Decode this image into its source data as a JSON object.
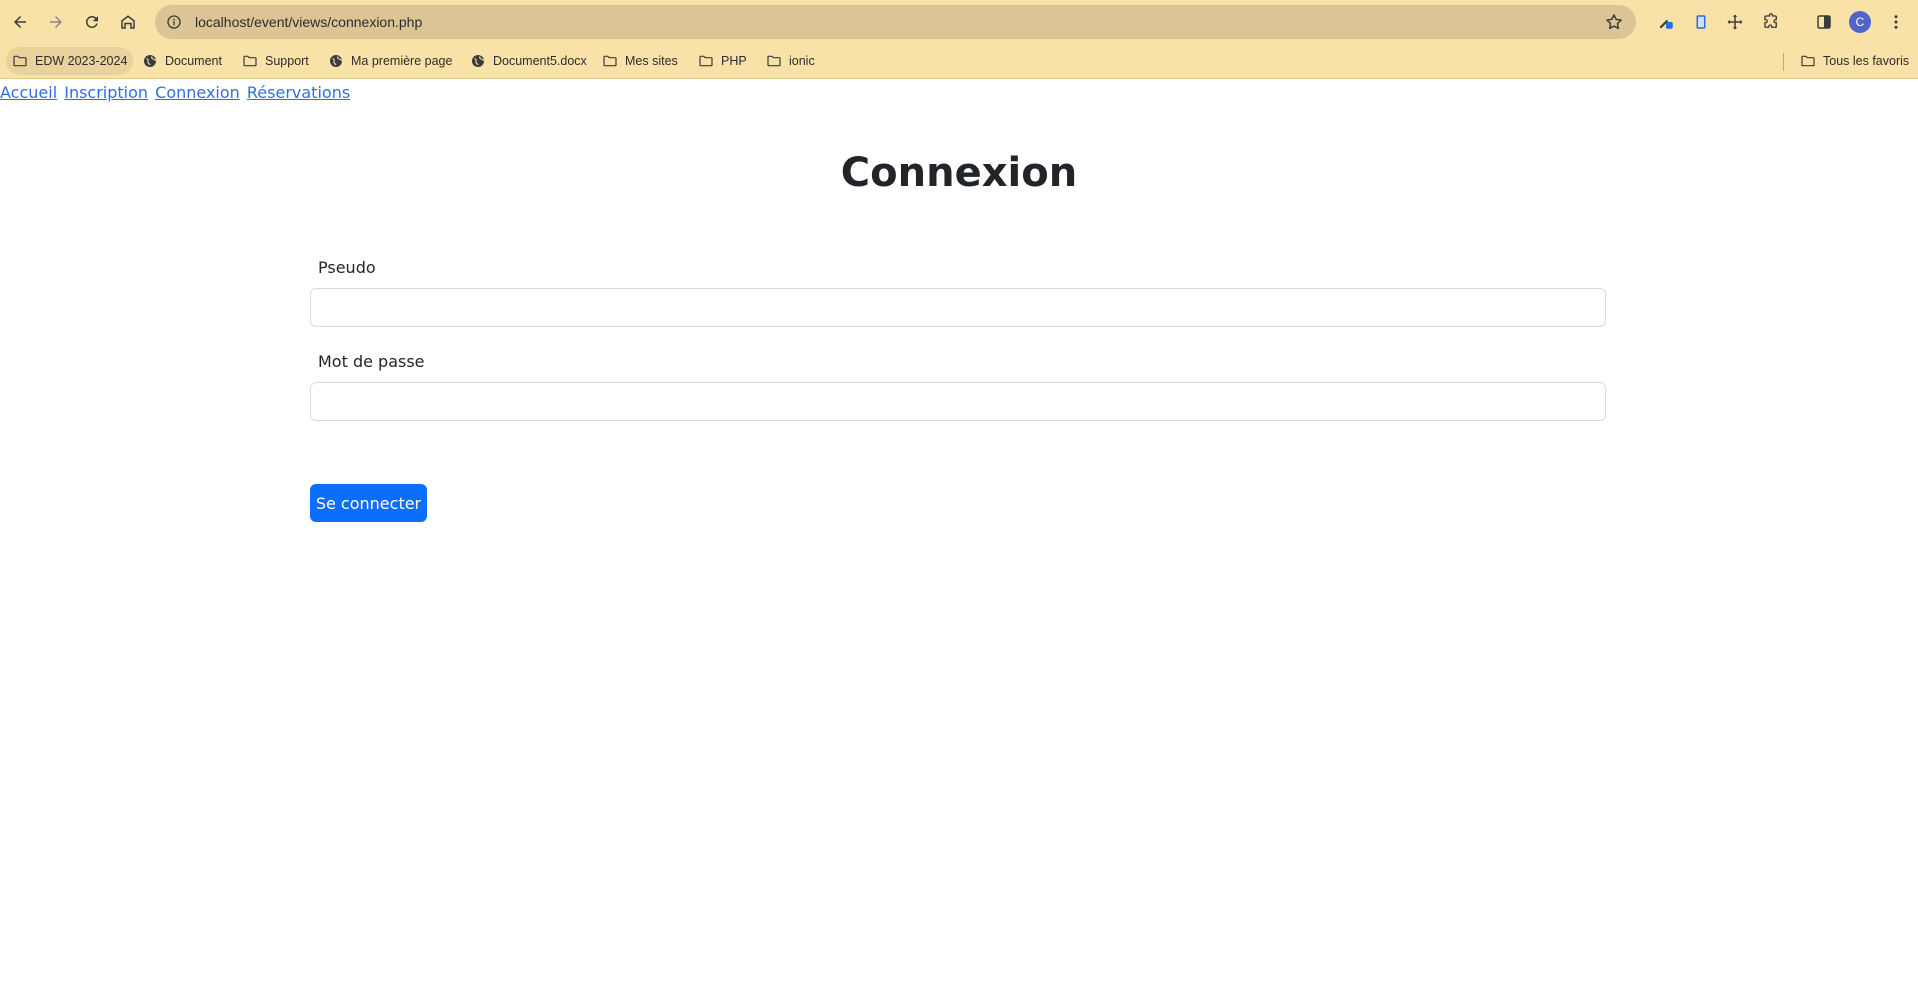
{
  "browser": {
    "url": "localhost/event/views/connexion.php",
    "bookmarks": [
      {
        "label": "EDW 2023-2024",
        "icon": "folder-icon"
      },
      {
        "label": "Document",
        "icon": "globe-icon"
      },
      {
        "label": "Support",
        "icon": "folder-icon"
      },
      {
        "label": "Ma première page",
        "icon": "globe-icon"
      },
      {
        "label": "Document5.docx",
        "icon": "globe-icon"
      },
      {
        "label": "Mes sites",
        "icon": "folder-icon"
      },
      {
        "label": "PHP",
        "icon": "folder-icon"
      },
      {
        "label": "ionic",
        "icon": "folder-icon"
      }
    ],
    "all_bookmarks": "Tous les favoris",
    "profile_initial": "C"
  },
  "nav": {
    "links": [
      "Accueil",
      "Inscription",
      "Connexion",
      "Réservations"
    ]
  },
  "page": {
    "title": "Connexion",
    "pseudo_label": "Pseudo",
    "pseudo_value": "",
    "password_label": "Mot de passe",
    "password_value": "",
    "submit_label": "Se connecter"
  },
  "colors": {
    "chrome_bg": "#f8e2a8",
    "link": "#2f6fe3",
    "primary_button": "#0d6efd"
  }
}
